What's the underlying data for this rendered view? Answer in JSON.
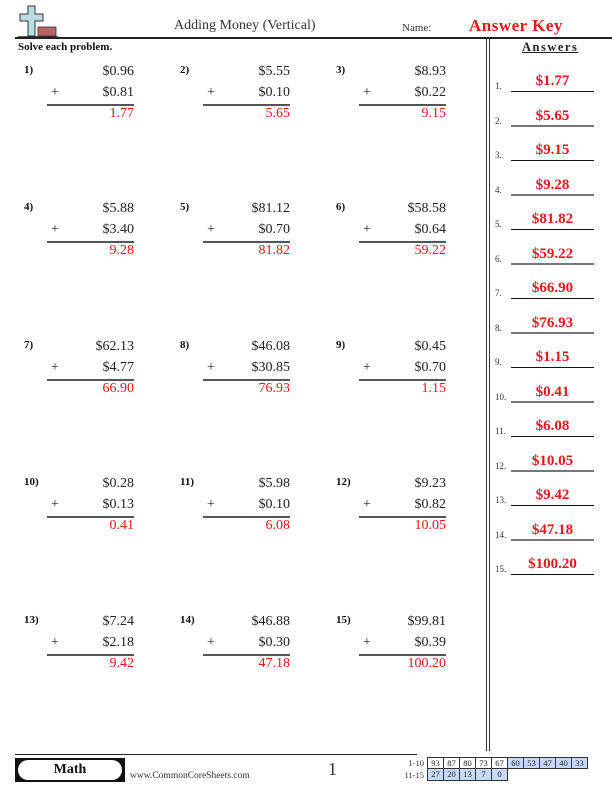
{
  "header": {
    "title": "Adding Money (Vertical)",
    "name_label": "Name:",
    "answer_key": "Answer Key",
    "logo_icon": "plus-sign-logo-icon"
  },
  "instructions": "Solve each problem.",
  "answers_heading": "Answers",
  "problems": [
    {
      "label": "1)",
      "top": "$0.96",
      "operator": "+",
      "bottom": "$0.81",
      "answer": "1.77"
    },
    {
      "label": "2)",
      "top": "$5.55",
      "operator": "+",
      "bottom": "$0.10",
      "answer": "5.65"
    },
    {
      "label": "3)",
      "top": "$8.93",
      "operator": "+",
      "bottom": "$0.22",
      "answer": "9.15"
    },
    {
      "label": "4)",
      "top": "$5.88",
      "operator": "+",
      "bottom": "$3.40",
      "answer": "9.28"
    },
    {
      "label": "5)",
      "top": "$81.12",
      "operator": "+",
      "bottom": "$0.70",
      "answer": "81.82"
    },
    {
      "label": "6)",
      "top": "$58.58",
      "operator": "+",
      "bottom": "$0.64",
      "answer": "59.22"
    },
    {
      "label": "7)",
      "top": "$62.13",
      "operator": "+",
      "bottom": "$4.77",
      "answer": "66.90"
    },
    {
      "label": "8)",
      "top": "$46.08",
      "operator": "+",
      "bottom": "$30.85",
      "answer": "76.93"
    },
    {
      "label": "9)",
      "top": "$0.45",
      "operator": "+",
      "bottom": "$0.70",
      "answer": "1.15"
    },
    {
      "label": "10)",
      "top": "$0.28",
      "operator": "+",
      "bottom": "$0.13",
      "answer": "0.41"
    },
    {
      "label": "11)",
      "top": "$5.98",
      "operator": "+",
      "bottom": "$0.10",
      "answer": "6.08"
    },
    {
      "label": "12)",
      "top": "$9.23",
      "operator": "+",
      "bottom": "$0.82",
      "answer": "10.05"
    },
    {
      "label": "13)",
      "top": "$7.24",
      "operator": "+",
      "bottom": "$2.18",
      "answer": "9.42"
    },
    {
      "label": "14)",
      "top": "$46.88",
      "operator": "+",
      "bottom": "$0.30",
      "answer": "47.18"
    },
    {
      "label": "15)",
      "top": "$99.81",
      "operator": "+",
      "bottom": "$0.39",
      "answer": "100.20"
    }
  ],
  "answer_key": [
    {
      "num": "1.",
      "value": "$1.77"
    },
    {
      "num": "2.",
      "value": "$5.65"
    },
    {
      "num": "3.",
      "value": "$9.15"
    },
    {
      "num": "4.",
      "value": "$9.28"
    },
    {
      "num": "5.",
      "value": "$81.82"
    },
    {
      "num": "6.",
      "value": "$59.22"
    },
    {
      "num": "7.",
      "value": "$66.90"
    },
    {
      "num": "8.",
      "value": "$76.93"
    },
    {
      "num": "9.",
      "value": "$1.15"
    },
    {
      "num": "10.",
      "value": "$0.41"
    },
    {
      "num": "11.",
      "value": "$6.08"
    },
    {
      "num": "12.",
      "value": "$10.05"
    },
    {
      "num": "13.",
      "value": "$9.42"
    },
    {
      "num": "14.",
      "value": "$47.18"
    },
    {
      "num": "15.",
      "value": "$100.20"
    }
  ],
  "footer": {
    "subject": "Math",
    "website": "www.CommonCoreSheets.com",
    "page_number": "1",
    "score_rows": [
      {
        "label": "1-10",
        "cells": [
          "93",
          "87",
          "80",
          "73",
          "67",
          "60",
          "53",
          "47",
          "40",
          "33"
        ],
        "blue_from": 5
      },
      {
        "label": "11-15",
        "cells": [
          "27",
          "20",
          "13",
          "7",
          "0"
        ],
        "blue_from": 0
      }
    ]
  },
  "colors": {
    "answer_red": "#e8171c",
    "score_blue": "#c6daf8"
  }
}
